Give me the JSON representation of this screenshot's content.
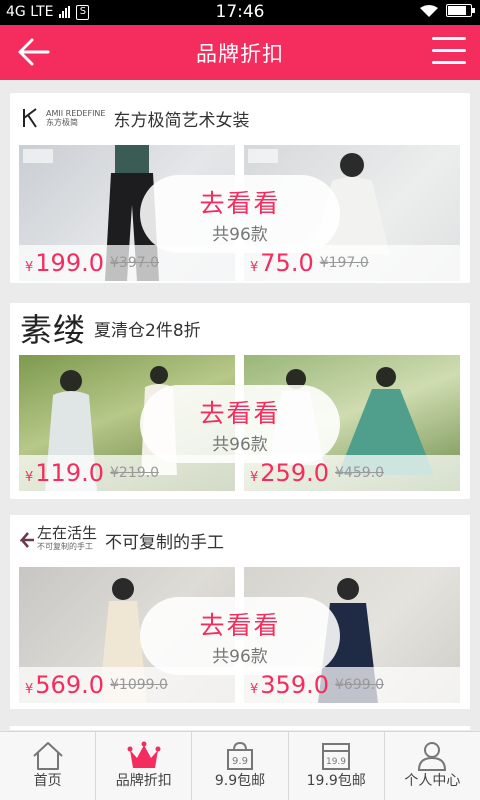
{
  "status_bar": {
    "network": "4G LTE",
    "time": "17:46"
  },
  "header": {
    "title": "品牌折扣"
  },
  "cards": [
    {
      "logo_text": "AMII REDEFINE",
      "logo_sub": "东方极简",
      "tagline": "东方极简艺术女装",
      "prices": [
        {
          "price": "199.0",
          "old": "397.0"
        },
        {
          "price": "75.0",
          "old": "197.0"
        }
      ],
      "cta": "去看看",
      "count": "共96款"
    },
    {
      "logo_text": "素缕",
      "tagline": "夏清仓2件8折",
      "prices": [
        {
          "price": "119.0",
          "old": "219.0"
        },
        {
          "price": "259.0",
          "old": "459.0"
        }
      ],
      "cta": "去看看",
      "count": "共96款"
    },
    {
      "logo_text": "左在活生",
      "logo_sub": "不可复制的手工",
      "tagline": "不可复制的手工",
      "prices": [
        {
          "price": "569.0",
          "old": "1099.0"
        },
        {
          "price": "359.0",
          "old": "699.0"
        }
      ],
      "cta": "去看看",
      "count": "共96款"
    }
  ],
  "currency": "¥",
  "tabs": [
    {
      "label": "首页",
      "icon": "home-icon"
    },
    {
      "label": "品牌折扣",
      "icon": "crown-icon"
    },
    {
      "label": "9.9包邮",
      "icon": "bag-icon",
      "badge": "9.9"
    },
    {
      "label": "19.9包邮",
      "icon": "shop-icon",
      "badge": "19.9"
    },
    {
      "label": "个人中心",
      "icon": "user-icon"
    }
  ],
  "colors": {
    "accent": "#f52c5e"
  }
}
